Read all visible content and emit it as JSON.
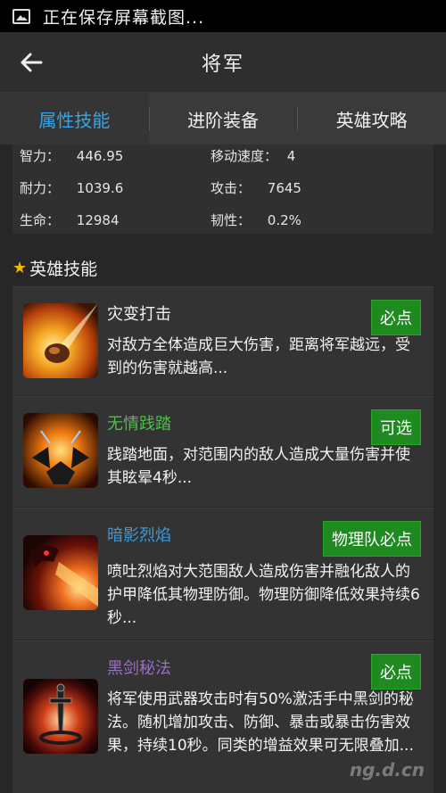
{
  "status_bar": {
    "icon": "image-icon",
    "text": "正在保存屏幕截图..."
  },
  "app_bar": {
    "back_icon": "back-arrow-icon",
    "title": "将军"
  },
  "tabs": [
    {
      "label": "属性技能",
      "active": true
    },
    {
      "label": "进阶装备",
      "active": false
    },
    {
      "label": "英雄攻略",
      "active": false
    }
  ],
  "stats": [
    {
      "label": "智力：",
      "value": "446.95"
    },
    {
      "label": "移动速度：",
      "value": "4"
    },
    {
      "label": "耐力：",
      "value": "1039.6"
    },
    {
      "label": "攻击：",
      "value": "7645"
    },
    {
      "label": "生命：",
      "value": "12984"
    },
    {
      "label": "韧性：",
      "value": "0.2%"
    }
  ],
  "skills_section": {
    "title": "英雄技能",
    "icon": "star-icon"
  },
  "skills": [
    {
      "name": "灾变打击",
      "name_color": "#f2f2f2",
      "badge": "必点",
      "desc": "对敌方全体造成巨大伤害，距离将军越远，受到的伤害就越高...",
      "icon": "meteor-strike-icon"
    },
    {
      "name": "无情践踏",
      "name_color": "#4fbf4f",
      "badge": "可选",
      "desc": "践踏地面，对范围内的敌人造成大量伤害并使其眩晕4秒...",
      "icon": "ground-stomp-icon"
    },
    {
      "name": "暗影烈焰",
      "name_color": "#3a9ad9",
      "badge": "物理队必点",
      "desc": "喷吐烈焰对大范围敌人造成伤害并融化敌人的护甲降低其物理防御。物理防御降低效果持续6秒...",
      "icon": "dragon-flame-icon"
    },
    {
      "name": "黑剑秘法",
      "name_color": "#9a6ec8",
      "badge": "必点",
      "desc": "将军使用武器攻击时有50%激活手中黑剑的秘法。随机增加攻击、防御、暴击或暴击伤害效果，持续10秒。同类的增益效果可无限叠加...",
      "icon": "black-sword-icon"
    }
  ],
  "watermark": "ng.d.cn",
  "colors": {
    "accent": "#34a6e8",
    "badge_green": "#1f8a1f",
    "background": "#272727"
  }
}
